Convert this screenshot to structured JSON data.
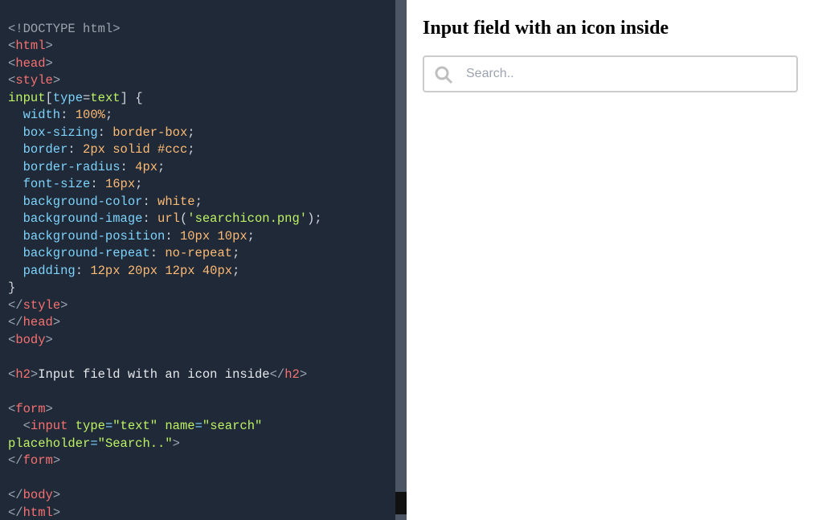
{
  "code": {
    "l1_a": "<!DOCTYPE html",
    "l1_b": ">",
    "l2_a": "<",
    "l2_b": "html",
    "l2_c": ">",
    "l3_a": "<",
    "l3_b": "head",
    "l3_c": ">",
    "l4_a": "<",
    "l4_b": "style",
    "l4_c": ">",
    "l5_a": "input",
    "l5_b": "[",
    "l5_c": "type",
    "l5_d": "=",
    "l5_e": "text",
    "l5_f": "]",
    "l5_g": " {",
    "l6_a": "  width",
    "l6_b": ": ",
    "l6_c": "100%",
    "l6_d": ";",
    "l7_a": "  box-sizing",
    "l7_b": ": ",
    "l7_c": "border-box",
    "l7_d": ";",
    "l8_a": "  border",
    "l8_b": ": ",
    "l8_c": "2px solid #ccc",
    "l8_d": ";",
    "l9_a": "  border-radius",
    "l9_b": ": ",
    "l9_c": "4px",
    "l9_d": ";",
    "l10_a": "  font-size",
    "l10_b": ": ",
    "l10_c": "16px",
    "l10_d": ";",
    "l11_a": "  background-color",
    "l11_b": ": ",
    "l11_c": "white",
    "l11_d": ";",
    "l12_a": "  background-image",
    "l12_b": ": ",
    "l12_c": "url",
    "l12_d": "(",
    "l12_e": "'searchicon.png'",
    "l12_f": ")",
    "l12_g": ";",
    "l13_a": "  background-position",
    "l13_b": ": ",
    "l13_c": "10px 10px",
    "l13_d": ";",
    "l14_a": "  background-repeat",
    "l14_b": ": ",
    "l14_c": "no-repeat",
    "l14_d": ";",
    "l15_a": "  padding",
    "l15_b": ": ",
    "l15_c": "12px 20px 12px 40px",
    "l15_d": ";",
    "l16": "}",
    "l17_a": "</",
    "l17_b": "style",
    "l17_c": ">",
    "l18_a": "</",
    "l18_b": "head",
    "l18_c": ">",
    "l19_a": "<",
    "l19_b": "body",
    "l19_c": ">",
    "l20": "",
    "l21_a": "<",
    "l21_b": "h2",
    "l21_c": ">",
    "l21_d": "Input field with an icon inside",
    "l21_e": "</",
    "l21_f": "h2",
    "l21_g": ">",
    "l22": "",
    "l23_a": "<",
    "l23_b": "form",
    "l23_c": ">",
    "l24_a": "  <",
    "l24_b": "input",
    "l24_c": " type",
    "l24_d": "=",
    "l24_e": "\"text\"",
    "l24_f": " name",
    "l24_g": "=",
    "l24_h": "\"search\"",
    "l25_a": "placeholder",
    "l25_b": "=",
    "l25_c": "\"Search..\"",
    "l25_d": ">",
    "l26_a": "</",
    "l26_b": "form",
    "l26_c": ">",
    "l27": "",
    "l28_a": "</",
    "l28_b": "body",
    "l28_c": ">",
    "l29_a": "</",
    "l29_b": "html",
    "l29_c": ">"
  },
  "preview": {
    "heading": "Input field with an icon inside",
    "placeholder": "Search.."
  }
}
